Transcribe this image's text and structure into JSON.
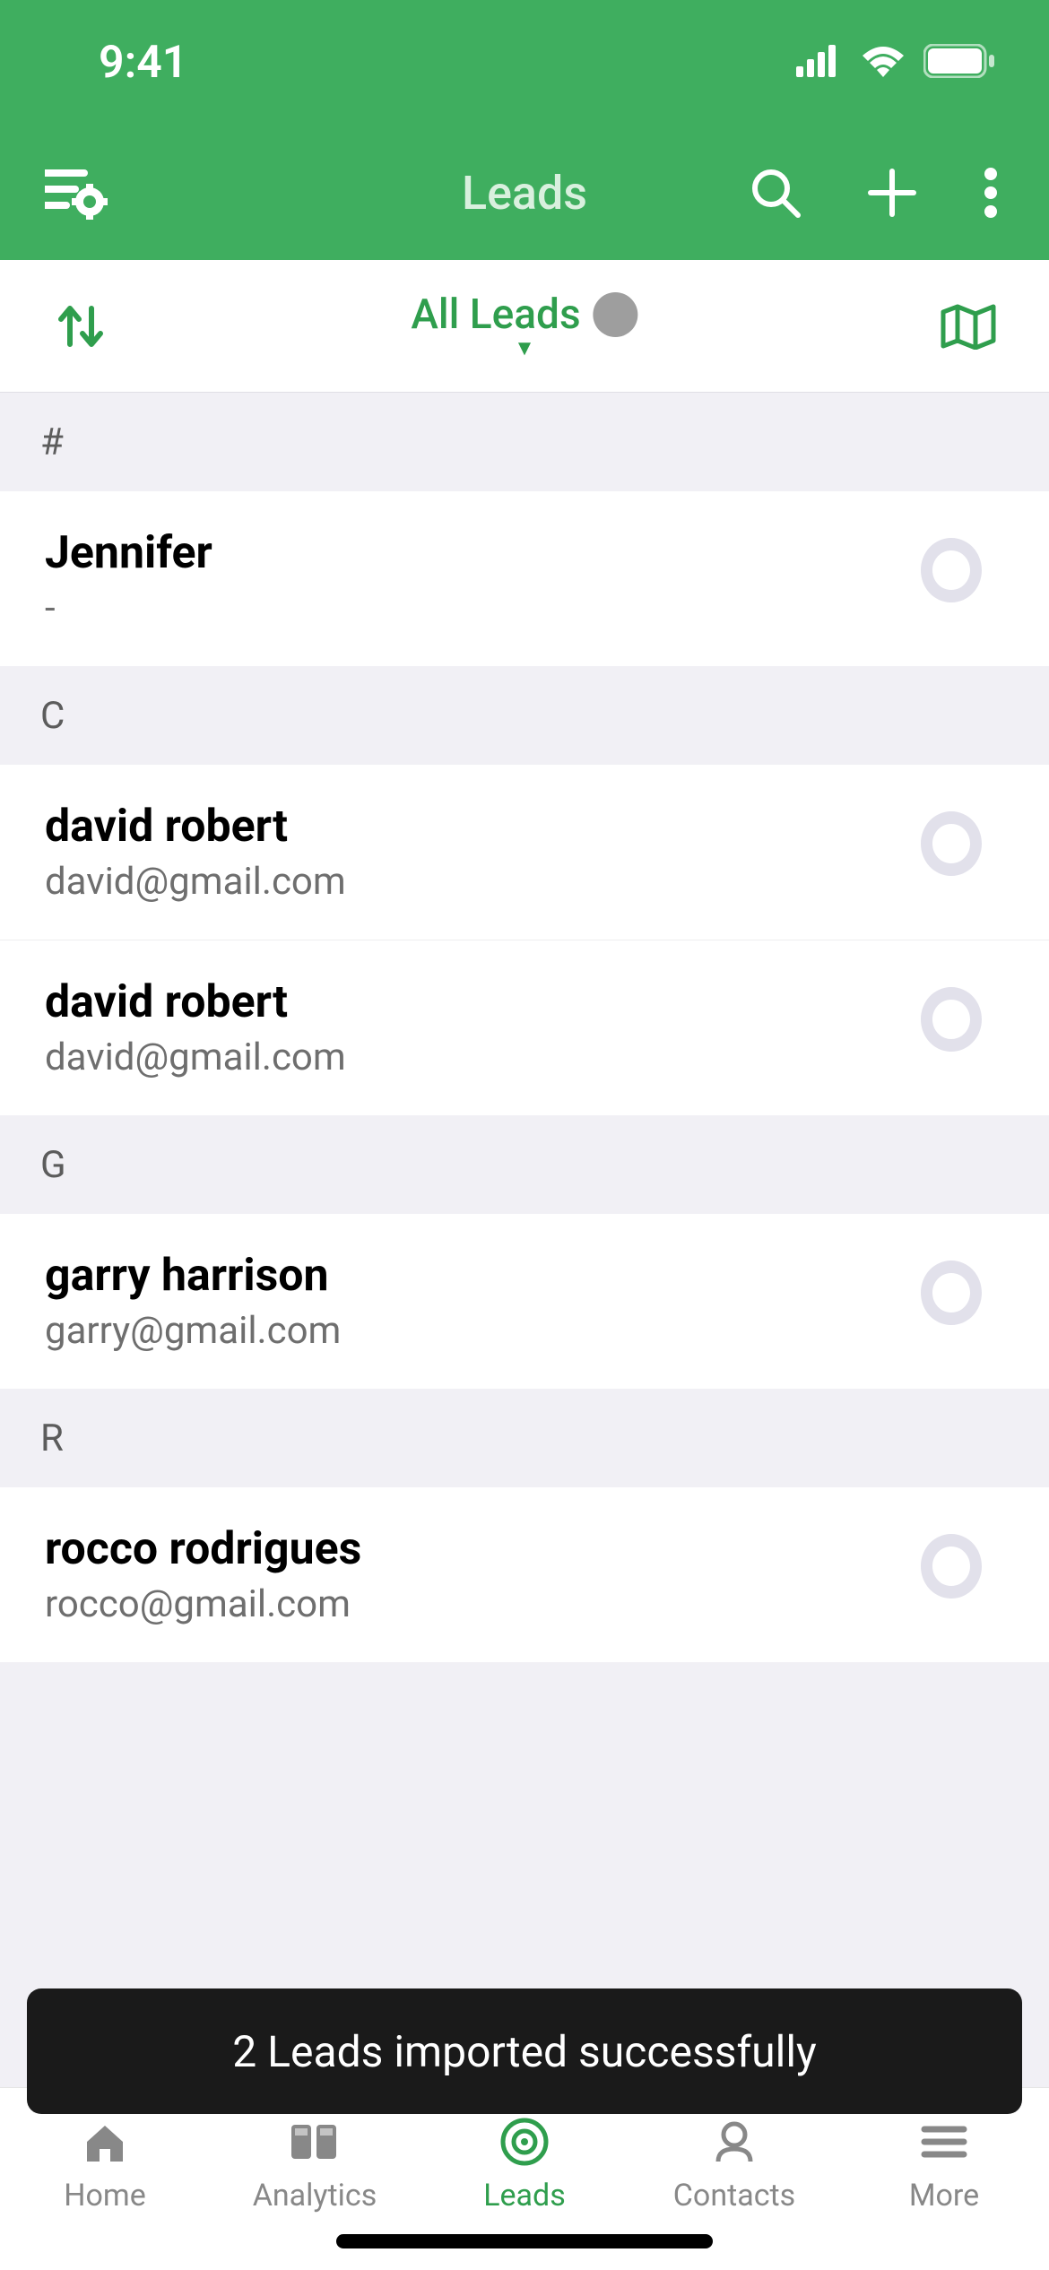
{
  "statusBar": {
    "time": "9:41"
  },
  "navHeader": {
    "title": "Leads"
  },
  "filterBar": {
    "label": "All Leads"
  },
  "sections": [
    {
      "letter": "#",
      "items": [
        {
          "name": "Jennifer",
          "sub": "-"
        }
      ]
    },
    {
      "letter": "C",
      "items": [
        {
          "name": "david robert",
          "sub": "david@gmail.com"
        },
        {
          "name": "david robert",
          "sub": "david@gmail.com"
        }
      ]
    },
    {
      "letter": "G",
      "items": [
        {
          "name": "garry harrison",
          "sub": "garry@gmail.com"
        }
      ]
    },
    {
      "letter": "R",
      "items": [
        {
          "name": "rocco rodrigues",
          "sub": "rocco@gmail.com"
        }
      ]
    }
  ],
  "toast": {
    "message": "2 Leads imported successfully"
  },
  "tabs": [
    {
      "label": "Home",
      "active": false
    },
    {
      "label": "Analytics",
      "active": false
    },
    {
      "label": "Leads",
      "active": true
    },
    {
      "label": "Contacts",
      "active": false
    },
    {
      "label": "More",
      "active": false
    }
  ]
}
